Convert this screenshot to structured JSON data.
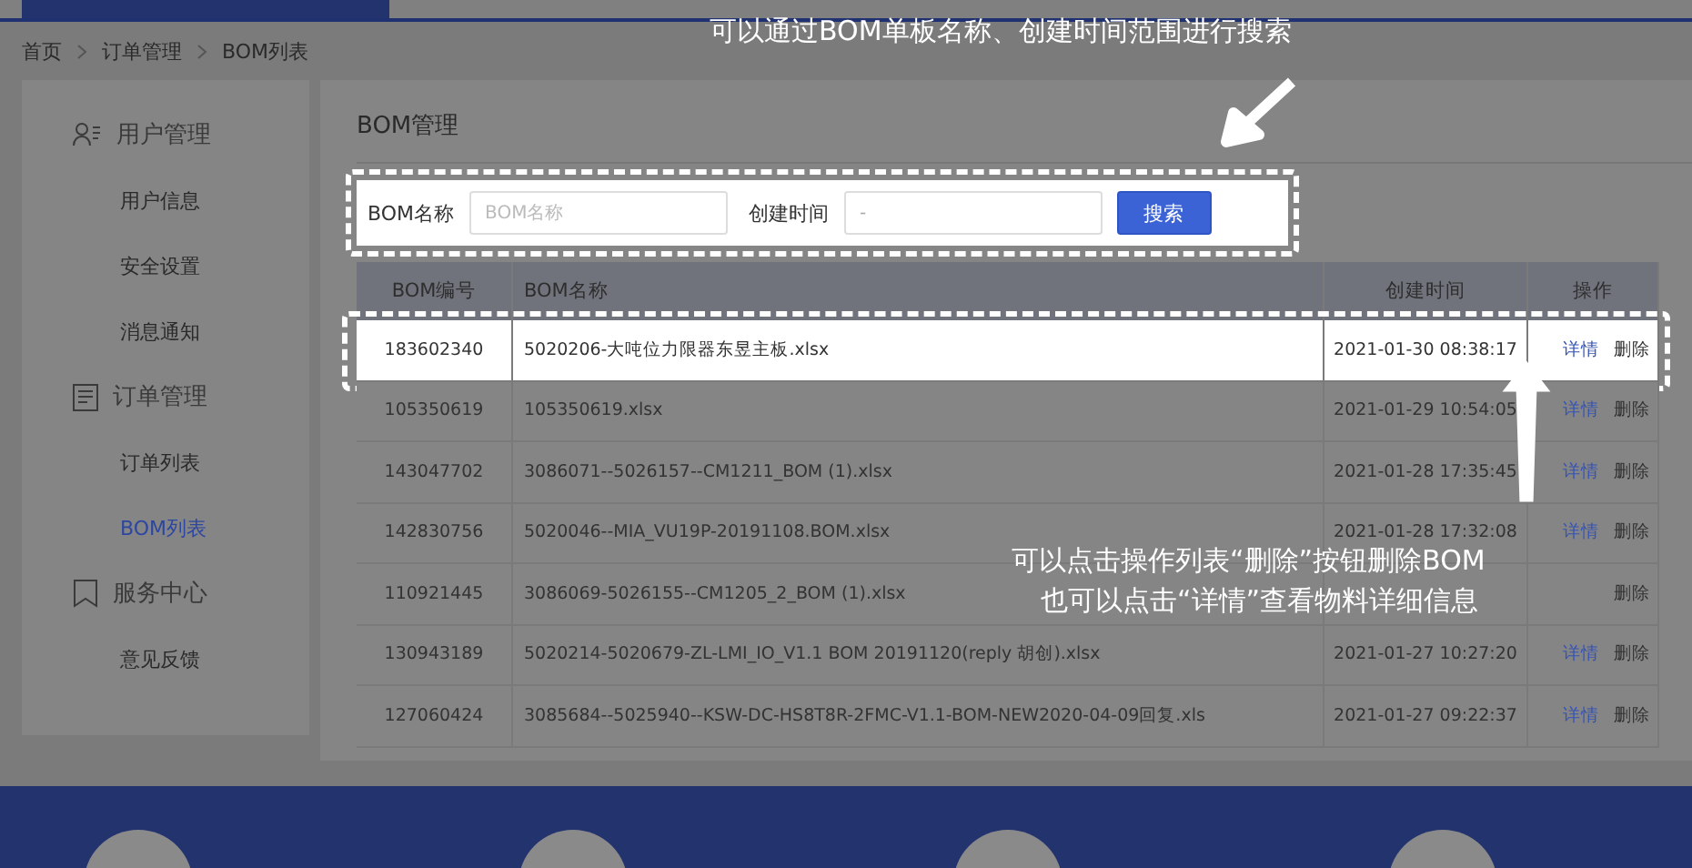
{
  "breadcrumb": [
    "首页",
    "订单管理",
    "BOM列表"
  ],
  "sidebar": [
    {
      "title": "用户管理",
      "items": [
        {
          "label": "用户信息",
          "selected": false
        },
        {
          "label": "安全设置",
          "selected": false
        },
        {
          "label": "消息通知",
          "selected": false
        }
      ]
    },
    {
      "title": "订单管理",
      "items": [
        {
          "label": "订单列表",
          "selected": false
        },
        {
          "label": "BOM列表",
          "selected": true
        }
      ]
    },
    {
      "title": "服务中心",
      "items": [
        {
          "label": "意见反馈",
          "selected": false
        }
      ]
    }
  ],
  "panel_title": "BOM管理",
  "search": {
    "highlighted": true,
    "name_label": "BOM名称",
    "name_placeholder": "BOM名称",
    "time_label": "创建时间",
    "time_value": "-",
    "button": "搜索"
  },
  "table": {
    "columns": [
      "BOM编号",
      "BOM名称",
      "创建时间",
      "操作"
    ],
    "rows": [
      {
        "id": "183602340",
        "name": "5020206-大吨位力限器东昱主板.xlsx",
        "time": "2021-01-30 08:38:17",
        "highlighted": true,
        "actions": [
          {
            "label": "详情",
            "kind": "detail"
          },
          {
            "label": "删除",
            "kind": "delete"
          }
        ]
      },
      {
        "id": "105350619",
        "name": "105350619.xlsx",
        "time": "2021-01-29 10:54:05",
        "highlighted": false,
        "actions": [
          {
            "label": "详情",
            "kind": "detail"
          },
          {
            "label": "删除",
            "kind": "delete"
          }
        ]
      },
      {
        "id": "143047702",
        "name": "3086071--5026157--CM1211_BOM (1).xlsx",
        "time": "2021-01-28 17:35:45",
        "highlighted": false,
        "actions": [
          {
            "label": "详情",
            "kind": "detail"
          },
          {
            "label": "删除",
            "kind": "delete"
          }
        ]
      },
      {
        "id": "142830756",
        "name": "5020046--MIA_VU19P-20191108.BOM.xlsx",
        "time": "2021-01-28 17:32:08",
        "highlighted": false,
        "actions": [
          {
            "label": "详情",
            "kind": "detail"
          },
          {
            "label": "删除",
            "kind": "delete"
          }
        ]
      },
      {
        "id": "110921445",
        "name": "3086069-5026155--CM1205_2_BOM (1).xlsx",
        "highlighted": false,
        "actions": [
          {
            "label": "删除",
            "kind": "delete"
          }
        ]
      },
      {
        "id": "130943189",
        "name": "5020214-5020679-ZL-LMI_IO_V1.1 BOM 20191120(reply 胡创).xlsx",
        "time": "2021-01-27 10:27:20",
        "highlighted": false,
        "actions": [
          {
            "label": "详情",
            "kind": "detail"
          },
          {
            "label": "删除",
            "kind": "delete"
          }
        ]
      },
      {
        "id": "127060424",
        "name": "3085684--5025940--KSW-DC-HS8T8R-2FMC-V1.1-BOM-NEW2020-04-09回复.xls",
        "time": "2021-01-27 09:22:37",
        "highlighted": false,
        "actions": [
          {
            "label": "详情",
            "kind": "detail"
          },
          {
            "label": "删除",
            "kind": "delete"
          }
        ]
      }
    ]
  },
  "annotations": [
    {
      "kind": "search",
      "text": "可以通过BOM单板名称、创建时间范围进行搜索"
    },
    {
      "kind": "row",
      "lines": [
        "可以点击操作列表“删除”按钮删除BOM",
        "也可以点击“详情”查看物料详细信息"
      ]
    }
  ]
}
